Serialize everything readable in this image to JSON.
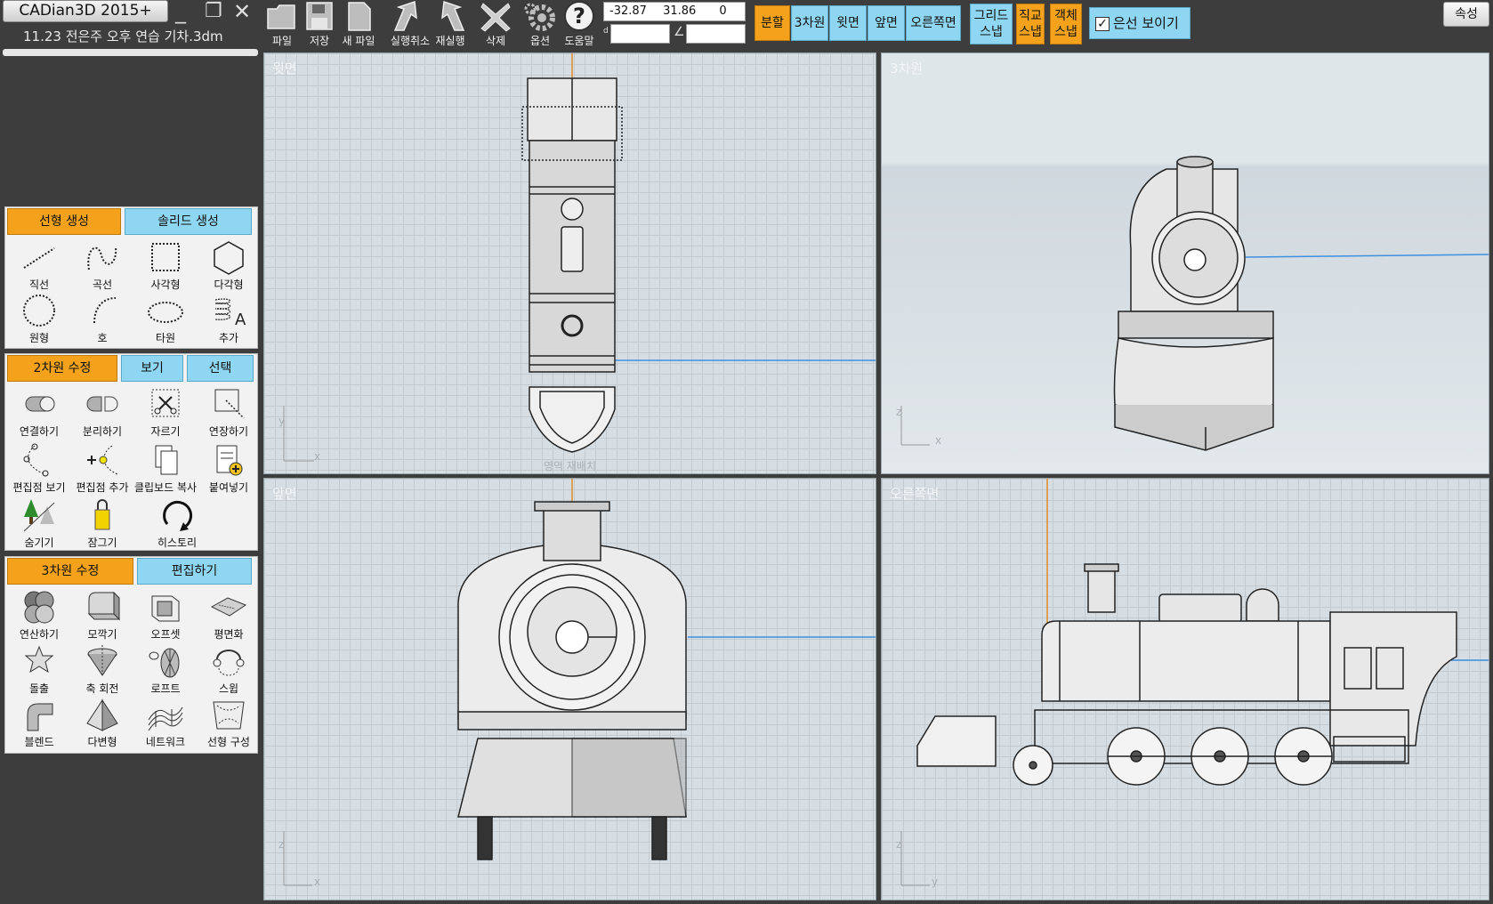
{
  "app": {
    "title": "CADian3D 2015+",
    "file_name": "11.23 전은주 오후 연습 기차.3dm"
  },
  "window_controls": {
    "minimize": "_",
    "restore": "❐",
    "close": "✕"
  },
  "toolbar": {
    "file": "파일",
    "save": "저장",
    "new_file": "새 파일",
    "undo": "실행취소",
    "redo": "재실행",
    "delete": "삭제",
    "options": "옵션",
    "help": "도움말"
  },
  "coords": {
    "x": "-32.87",
    "y": "31.86",
    "z": "0",
    "distance": "",
    "angle": ""
  },
  "view_buttons": {
    "split": "분할",
    "three_d": "3차원",
    "top": "윗면",
    "front": "앞면",
    "right": "오른쪽면"
  },
  "snap_buttons": {
    "grid": [
      "그리드",
      "스냅"
    ],
    "ortho": [
      "직교",
      "스냅"
    ],
    "object": [
      "객체",
      "스냅"
    ]
  },
  "show_hidden_lines": {
    "label": "은선 보이기",
    "checked": true
  },
  "properties_button": "속성",
  "panel_curve": {
    "tabs": [
      "선형 생성",
      "솔리드 생성"
    ],
    "tools": [
      "직선",
      "곡선",
      "사각형",
      "다각형",
      "원형",
      "호",
      "타원",
      "추가"
    ]
  },
  "panel_2d": {
    "tabs": [
      "2차원 수정",
      "보기",
      "선택"
    ],
    "tools": [
      "연결하기",
      "분리하기",
      "자르기",
      "연장하기",
      "편집점 보기",
      "편집점 추가",
      "클립보드 복사",
      "붙여넣기",
      "숨기기",
      "잠그기",
      "히스토리"
    ]
  },
  "panel_3d": {
    "tabs": [
      "3차원 수정",
      "편집하기"
    ],
    "tools": [
      "연산하기",
      "모깍기",
      "오프셋",
      "평면화",
      "돌출",
      "축 회전",
      "로프트",
      "스윕",
      "블렌드",
      "다변형",
      "네트워크",
      "선형 구성"
    ]
  },
  "viewports": {
    "top": {
      "label": "윗면",
      "hint": "영역 재배치",
      "axis1": "y",
      "axis2": "x"
    },
    "persp": {
      "label": "3차원",
      "axis1": "z",
      "axis2": "x"
    },
    "front": {
      "label": "앞면",
      "axis1": "z",
      "axis2": "x"
    },
    "right": {
      "label": "오른쪽면",
      "axis1": "z",
      "axis2": "y"
    }
  },
  "colors": {
    "accent_orange": "#f4a21b",
    "tab_blue": "#8fd6f2",
    "axis_blue": "#3d8fe0",
    "axis_orange": "#e08a2a"
  }
}
